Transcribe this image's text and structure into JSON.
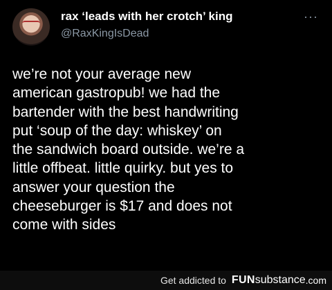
{
  "tweet": {
    "display_name": "rax ‘leads with her crotch’ king",
    "handle": "@RaxKingIsDead",
    "more_icon": "more-horizontal-icon",
    "more_label": "···",
    "text": "we’re not your average new\namerican gastropub! we had the\nbartender with the best handwriting\nput ‘soup of the day: whiskey’ on\nthe sandwich board outside. we’re a\nlittle offbeat. little quirky. but yes to\nanswer your question the\ncheeseburger is $17 and does not\ncome with sides"
  },
  "footer": {
    "credit": "Get addicted to",
    "brand_fun": "FUN",
    "brand_sub": "substance",
    "brand_tld": ".com"
  }
}
